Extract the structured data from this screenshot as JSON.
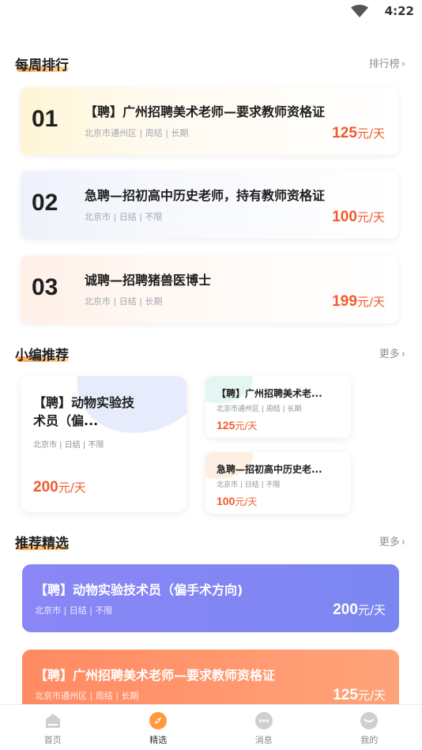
{
  "status_bar": {
    "time": "4:22"
  },
  "weekly_rank": {
    "title": "每周排行",
    "more_label": "排行榜",
    "items": [
      {
        "rank": "01",
        "title": "【聘】广州招聘美术老师—要求教师资格证",
        "meta": "北京市通州区 | 周结 | 长期",
        "pay_amount": "125",
        "pay_unit": "元/天"
      },
      {
        "rank": "02",
        "title": "急聘—招初高中历史老师，持有教师资格证",
        "meta": "北京市 | 日结 | 不限",
        "pay_amount": "100",
        "pay_unit": "元/天"
      },
      {
        "rank": "03",
        "title": "诚聘—招聘猪兽医博士",
        "meta": "北京市 | 日结 | 长期",
        "pay_amount": "199",
        "pay_unit": "元/天"
      }
    ]
  },
  "editor_picks": {
    "title": "小编推荐",
    "more_label": "更多",
    "main": {
      "title": "【聘】动物实验技术员（偏...",
      "meta": "北京市 | 日结 | 不限",
      "pay_amount": "200",
      "pay_unit": "元/天"
    },
    "items": [
      {
        "title": "【聘】广州招聘美术老...",
        "meta": "北京市通州区 | 周结 | 长期",
        "pay_amount": "125",
        "pay_unit": "元/天"
      },
      {
        "title": "急聘—招初高中历史老...",
        "meta": "北京市 | 日结 | 不限",
        "pay_amount": "100",
        "pay_unit": "元/天"
      }
    ]
  },
  "featured": {
    "title": "推荐精选",
    "more_label": "更多",
    "items": [
      {
        "title": "【聘】动物实验技术员（偏手术方向)",
        "meta": "北京市 | 日结 | 不限",
        "pay_amount": "200",
        "pay_unit": "元/天"
      },
      {
        "title": "【聘】广州招聘美术老师—要求教师资格证",
        "meta": "北京市通州区 | 周结 | 长期",
        "pay_amount": "125",
        "pay_unit": "元/天"
      }
    ]
  },
  "tabbar": {
    "items": [
      {
        "label": "首页",
        "icon": "home-icon"
      },
      {
        "label": "精选",
        "icon": "compass-icon",
        "active": true
      },
      {
        "label": "消息",
        "icon": "message-icon"
      },
      {
        "label": "我的",
        "icon": "profile-icon"
      }
    ]
  },
  "colors": {
    "accent": "#f05a2c",
    "tab_active": "#ff9a3c",
    "tab_inactive": "#cfcfcf"
  }
}
